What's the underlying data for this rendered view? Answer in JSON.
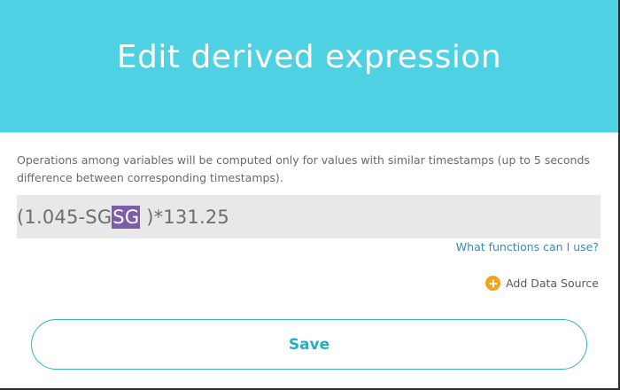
{
  "dialog": {
    "title": "Edit derived expression",
    "description": "Operations among variables will be computed only for values with similar timestamps (up to 5 seconds difference between corresponding timestamps).",
    "expression": {
      "before": "(1.045-SG",
      "highlighted": "SG",
      "after": " )*131.25"
    },
    "help_link": "What functions can I use?",
    "add_data_source": "Add Data Source",
    "save_label": "Save"
  },
  "colors": {
    "header_bg": "#4dd1e3",
    "accent": "#1fb0c4",
    "highlight_bg": "#7b5ea6",
    "plus_icon": "#f4a31a",
    "link": "#3a8ab6"
  },
  "icons": {
    "add": "plus-circle-icon"
  }
}
